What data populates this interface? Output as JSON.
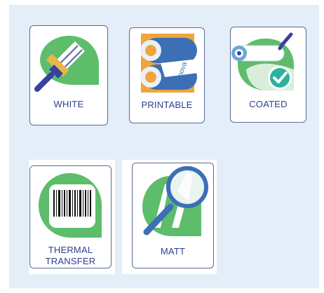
{
  "tiles": [
    {
      "label": "WHITE",
      "icon": "paint-brush-icon"
    },
    {
      "label": "PRINTABLE",
      "icon": "printing-rollers-icon",
      "roller_text": "nova"
    },
    {
      "label": "COATED",
      "icon": "paint-roller-check-icon"
    },
    {
      "label_line1": "THERMAL",
      "label_line2": "TRANSFER",
      "icon": "barcode-icon"
    },
    {
      "label": "MATT",
      "icon": "magnifier-icon"
    }
  ],
  "colors": {
    "panel_bg": "#e4eef9",
    "leaf_green": "#5ebd6a",
    "label_blue": "#2e3f8f",
    "border": "#5a6a9a"
  }
}
